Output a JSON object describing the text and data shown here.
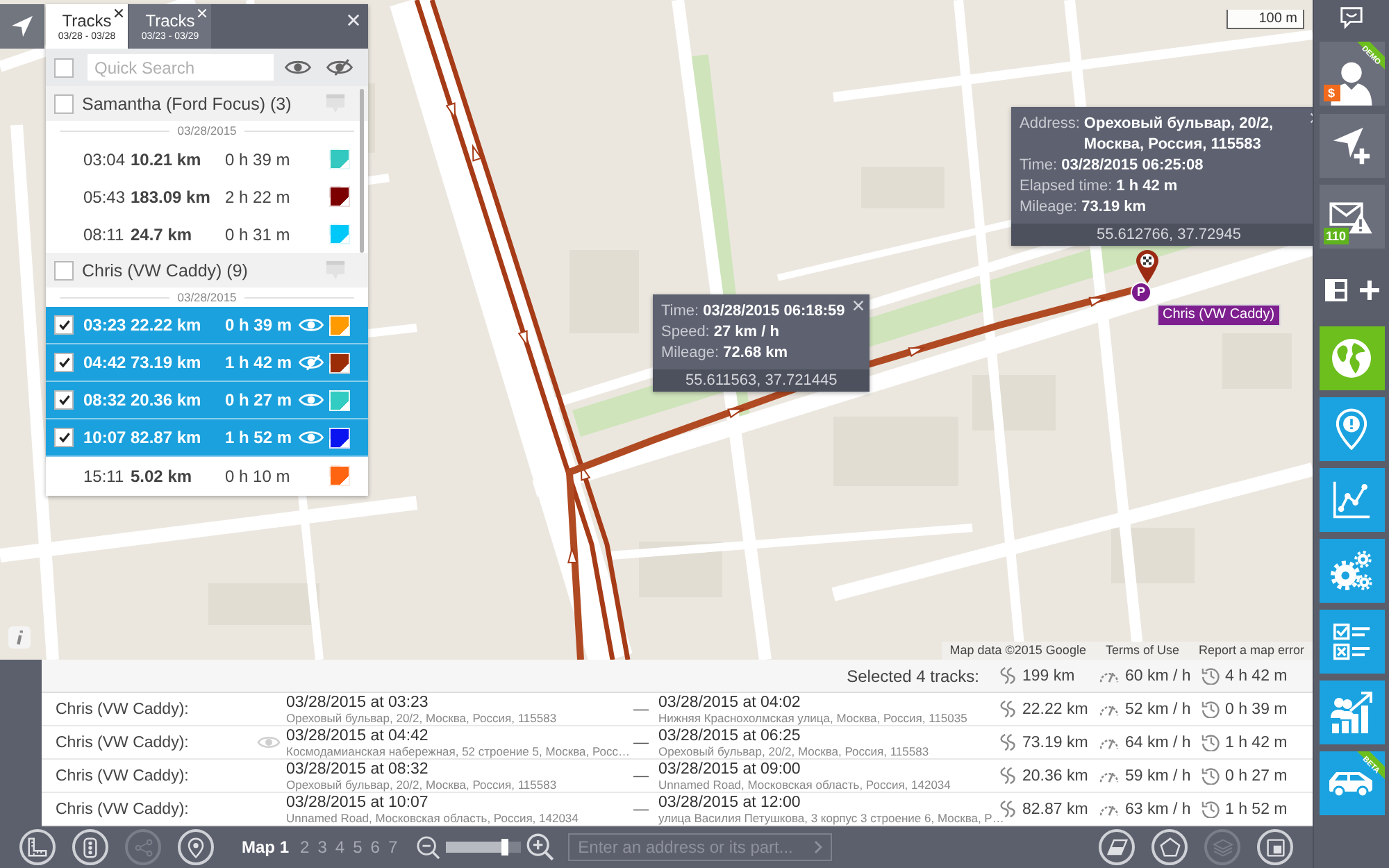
{
  "map": {
    "scale": "100 m",
    "tooltips": [
      {
        "lines": [
          {
            "label": "Address:",
            "value": "Ореховый бульвар, 20/2, Москва, Россия, 115583"
          },
          {
            "label": "Time:",
            "value": "03/28/2015 06:25:08"
          },
          {
            "label": "Elapsed time:",
            "value": "1 h 42 m"
          },
          {
            "label": "Mileage:",
            "value": "73.19 km"
          }
        ],
        "coordinates": "55.612766, 37.72945"
      },
      {
        "lines": [
          {
            "label": "Time:",
            "value": "03/28/2015 06:18:59"
          },
          {
            "label": "Speed:",
            "value": "27 km / h"
          },
          {
            "label": "Mileage:",
            "value": "72.68 km"
          }
        ],
        "coordinates": "55.611563, 37.721445"
      }
    ],
    "stop_marker": "P",
    "vehicle_label": "Chris (VW Caddy)",
    "attribution": [
      "Map data ©2015 Google",
      "Terms of Use",
      "Report a map error"
    ]
  },
  "tracks_panel": {
    "tabs": [
      {
        "title": "Tracks",
        "dates": "03/28 - 03/28",
        "selected": true
      },
      {
        "title": "Tracks",
        "dates": "03/23 - 03/29",
        "selected": false
      }
    ],
    "select_all": {
      "checked": false
    },
    "search": {
      "placeholder": "Quick Search"
    },
    "groups": [
      {
        "name": "Samantha (Ford Focus) (3)",
        "checked": false,
        "date": "03/28/2015",
        "children": [
          {
            "time": "03:04",
            "distance": "10.21 km",
            "duration": "0 h 39 m",
            "color": "#33c8c0",
            "selected": false
          },
          {
            "time": "05:43",
            "distance": "183.09 km",
            "duration": "2 h 22 m",
            "color": "#7d0000",
            "selected": false
          },
          {
            "time": "08:11",
            "distance": "24.7 km",
            "duration": "0 h 31 m",
            "color": "#00c8f8",
            "selected": false
          }
        ]
      },
      {
        "name": "Chris (VW Caddy) (9)",
        "checked": false,
        "date": "03/28/2015",
        "children": [
          {
            "time": "03:23",
            "distance": "22.22 km",
            "duration": "0 h 39 m",
            "color": "#ff9a00",
            "selected": true,
            "hidden": false
          },
          {
            "time": "04:42",
            "distance": "73.19 km",
            "duration": "1 h 42 m",
            "color": "#9c2c06",
            "selected": true,
            "hidden": true
          },
          {
            "time": "08:32",
            "distance": "20.36 km",
            "duration": "0 h 27 m",
            "color": "#33ccc2",
            "selected": true,
            "hidden": false
          },
          {
            "time": "10:07",
            "distance": "82.87 km",
            "duration": "1 h 52 m",
            "color": "#0a14f0",
            "selected": true,
            "hidden": false
          },
          {
            "time": "15:11",
            "distance": "5.02 km",
            "duration": "0 h 10 m",
            "color": "#ff6410",
            "selected": false
          }
        ]
      }
    ]
  },
  "summary": {
    "title": "Selected 4 tracks:",
    "distance": "199 km",
    "speed": "60 km / h",
    "duration": "4 h 42 m",
    "rows": [
      {
        "name": "Chris (VW Caddy):",
        "hidden": false,
        "start": "03/28/2015 at 03:23",
        "start_address": "Ореховый бульвар, 20/2, Москва, Россия, 115583",
        "dash": "—",
        "end": "03/28/2015 at 04:02",
        "end_address": "Нижняя Краснохолмская улица, Москва, Россия, 115035",
        "distance": "22.22 km",
        "speed": "52 km / h",
        "duration": "0 h 39 m"
      },
      {
        "name": "Chris (VW Caddy):",
        "hidden": true,
        "start": "03/28/2015 at 04:42",
        "start_address": "Космодамианская набережная, 52 строение 5, Москва, Росс…",
        "dash": "—",
        "end": "03/28/2015 at 06:25",
        "end_address": "Ореховый бульвар, 20/2, Москва, Россия, 115583",
        "distance": "73.19 km",
        "speed": "64 km / h",
        "duration": "1 h 42 m"
      },
      {
        "name": "Chris (VW Caddy):",
        "hidden": false,
        "start": "03/28/2015 at 08:32",
        "start_address": "Ореховый бульвар, 20/2, Москва, Россия, 115583",
        "dash": "—",
        "end": "03/28/2015 at 09:00",
        "end_address": "Unnamed Road, Московская область, Россия, 142034",
        "distance": "20.36 km",
        "speed": "59 km / h",
        "duration": "0 h 27 m"
      },
      {
        "name": "Chris (VW Caddy):",
        "hidden": false,
        "start": "03/28/2015 at 10:07",
        "start_address": "Unnamed Road, Московская область, Россия, 142034",
        "dash": "—",
        "end": "03/28/2015 at 12:00",
        "end_address": "улица Василия Петушкова, 3 корпус 3 строение 6, Москва, Р…",
        "distance": "82.87 km",
        "speed": "63 km / h",
        "duration": "1 h 52 m"
      }
    ]
  },
  "toolbar": {
    "left_tools": [
      {
        "kind": "ruler",
        "disabled": false
      },
      {
        "kind": "traffic",
        "disabled": false
      },
      {
        "kind": "share",
        "disabled": true
      },
      {
        "kind": "places",
        "disabled": false
      }
    ],
    "map_tabs": [
      {
        "label": "Map 1",
        "selected": true
      },
      {
        "label": "2",
        "selected": false
      },
      {
        "label": "3",
        "selected": false
      },
      {
        "label": "4",
        "selected": false
      },
      {
        "label": "5",
        "selected": false
      },
      {
        "label": "6",
        "selected": false
      },
      {
        "label": "7",
        "selected": false
      }
    ],
    "zoom": {
      "level": 0.8
    },
    "address_search": {
      "placeholder": "Enter an address or its part..."
    },
    "right_tools": [
      {
        "kind": "eraser",
        "disabled": false
      },
      {
        "kind": "polygon",
        "disabled": false
      },
      {
        "kind": "layers",
        "disabled": true
      },
      {
        "kind": "inset",
        "disabled": false
      }
    ]
  },
  "sidebar": {
    "account": {
      "ribbon": "DEMO",
      "badge": "$"
    },
    "messages": {
      "badge": "110"
    },
    "modules": [
      {
        "kind": "map",
        "selected": true
      },
      {
        "kind": "alerts",
        "selected": false
      },
      {
        "kind": "reports",
        "selected": false
      },
      {
        "kind": "settings",
        "selected": false
      },
      {
        "kind": "tasks",
        "selected": false
      },
      {
        "kind": "analytics",
        "selected": false
      },
      {
        "kind": "vehicles",
        "selected": false,
        "ribbon": "BETA"
      }
    ]
  }
}
